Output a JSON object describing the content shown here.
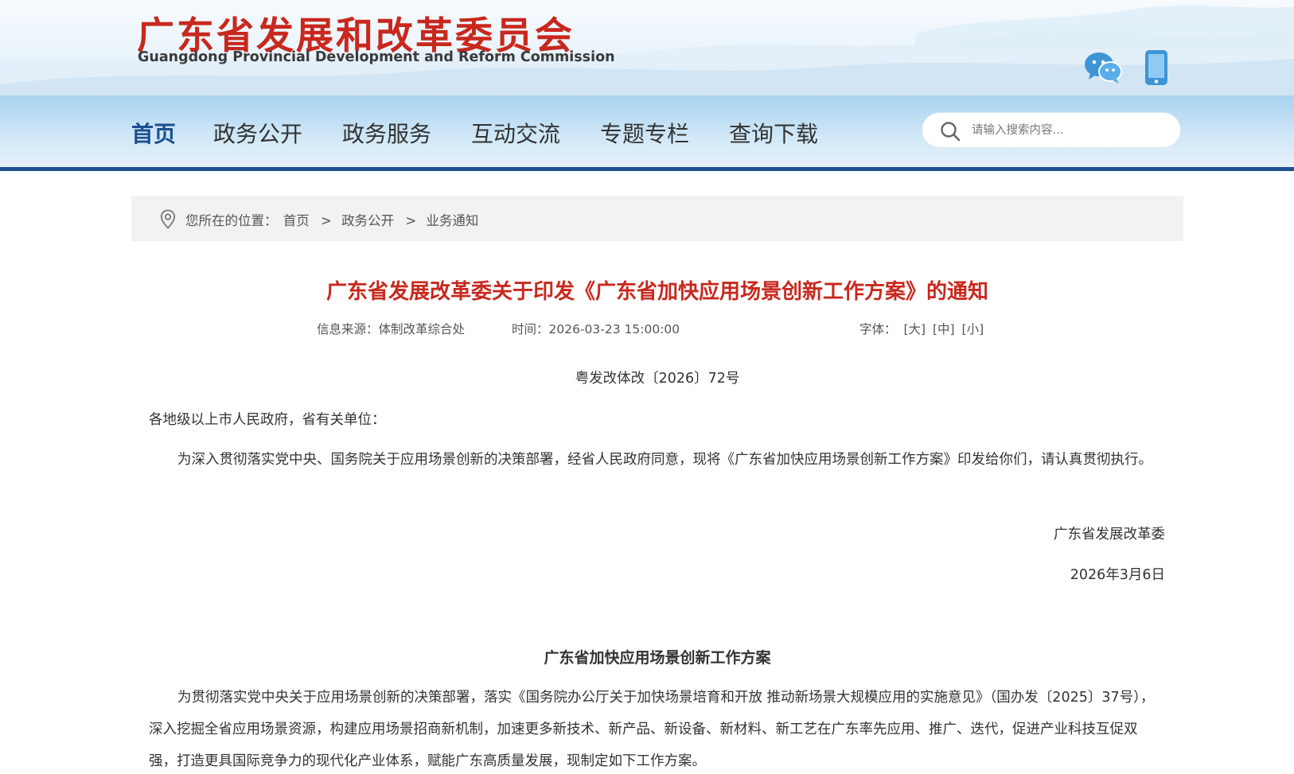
{
  "header": {
    "title": "广东省发展和改革委员会",
    "subtitle": "Guangdong Provincial Development and Reform Commission",
    "icons": [
      "wechat-icon",
      "mobile-icon"
    ]
  },
  "nav": {
    "items": [
      {
        "label": "首页",
        "active": true
      },
      {
        "label": "政务公开",
        "active": false
      },
      {
        "label": "政务服务",
        "active": false
      },
      {
        "label": "互动交流",
        "active": false
      },
      {
        "label": "专题专栏",
        "active": false
      },
      {
        "label": "查询下载",
        "active": false
      }
    ],
    "search_placeholder": "请输入搜索内容..."
  },
  "breadcrumb": {
    "prefix": "您所在的位置：",
    "items": [
      "首页",
      "政务公开",
      "业务通知"
    ],
    "separator": ">"
  },
  "article": {
    "title": "广东省发展改革委关于印发《广东省加快应用场景创新工作方案》的通知",
    "source_label": "信息来源：",
    "source": "体制改革综合处",
    "time_label": "时间：",
    "time": "2026-03-23 15:00:00",
    "font_label": "字体：",
    "font_options": [
      "[大]",
      "[中]",
      "[小]"
    ],
    "doc_number": "粤发改体改〔2026〕72号",
    "salutation": "各地级以上市人民政府，省有关单位：",
    "body": "为深入贯彻落实党中央、国务院关于应用场景创新的决策部署，经省人民政府同意，现将《广东省加快应用场景创新工作方案》印发给你们，请认真贯彻执行。",
    "signature": "广东省发展改革委",
    "date": "2026年3月6日",
    "plan_title": "广东省加快应用场景创新工作方案",
    "plan_intro": "为贯彻落实党中央关于应用场景创新的决策部署，落实《国务院办公厅关于加快场景培育和开放 推动新场景大规模应用的实施意见》（国办发〔2025〕37号），深入挖掘全省应用场景资源，构建应用场景招商新机制，加速更多新技术、新产品、新设备、新材料、新工艺在广东率先应用、推广、迭代，促进产业科技互促双强，打造更具国际竞争力的现代化产业体系，赋能广东高质量发展，现制定如下工作方案。"
  },
  "colors": {
    "brand_red": "#c8281e",
    "nav_blue": "#1c4f8f",
    "breadcrumb_bg": "#f2f2f2"
  }
}
